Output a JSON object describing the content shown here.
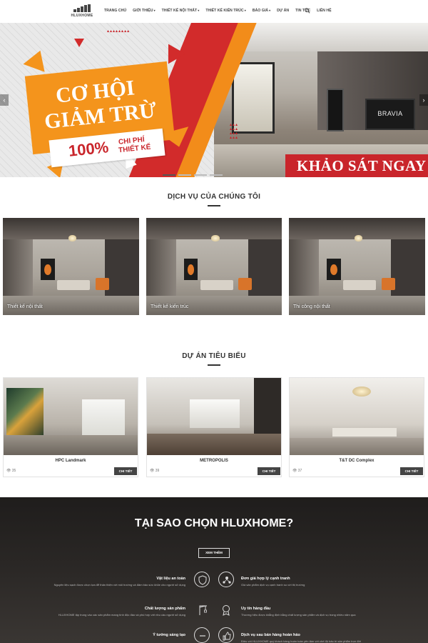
{
  "header": {
    "logo_text": "HLUXHOME",
    "nav": [
      {
        "label": "TRANG CHỦ",
        "caret": false
      },
      {
        "label": "GIỚI THIỆU",
        "caret": true
      },
      {
        "label": "THIẾT KẾ NỘI THẤT",
        "caret": true
      },
      {
        "label": "THIẾT KẾ KIẾN TRÚC",
        "caret": true
      },
      {
        "label": "BÁO GIÁ",
        "caret": true
      },
      {
        "label": "DỰ ÁN",
        "caret": false
      },
      {
        "label": "TIN TỨC",
        "caret": false
      },
      {
        "label": "LIÊN HỆ",
        "caret": false
      }
    ]
  },
  "hero": {
    "headline_line1": "CƠ HỘI",
    "headline_line2": "GIẢM TRỪ",
    "percent": "100%",
    "sub_line1": "CHI PHÍ",
    "sub_line2": "THIẾT KẾ",
    "cta": "KHẢO SÁT NGAY",
    "tv_brand": "BRAVIA",
    "prev_arrow": "‹",
    "next_arrow": "›"
  },
  "services": {
    "title": "DỊCH VỤ CỦA CHÚNG TÔI",
    "items": [
      {
        "label": "Thiết kế nội thất"
      },
      {
        "label": "Thiết kế kiến trúc"
      },
      {
        "label": "Thi công nội thất"
      }
    ]
  },
  "projects": {
    "title": "DỰ ÁN TIÊU BIỂU",
    "items": [
      {
        "name": "HPC Landmark",
        "views": "35",
        "button": "CHI TIẾT"
      },
      {
        "name": "METROPOLIS",
        "views": "39",
        "button": "CHI TIẾT"
      },
      {
        "name": "T&T DC Complex",
        "views": "37",
        "button": "CHI TIẾT"
      }
    ]
  },
  "why": {
    "title": "TẠI SAO CHỌN HLUXHOME?",
    "button": "XEM THÊM",
    "features": [
      {
        "title": "Vật liệu an toàn",
        "desc": "Nguyên liệu sạch được chọn lựa để thân thiện với môi trường và đảm bảo sức khỏe cho người sử dụng",
        "icon": "hand-shield-icon"
      },
      {
        "title": "Đơn giá hợp lý cạnh tranh",
        "desc": "Giá sản phẩm dịch vụ cạnh tranh so với thị trường",
        "icon": "people-network-icon"
      },
      {
        "title": "Chất lượng sản phẩm",
        "desc": "HLUXHOME tập trung vào các sản phẩm mang tính độc đáo và phù hợp với nhu cầu người sử dụng",
        "icon": "crane-icon"
      },
      {
        "title": "Uy tín hàng đầu",
        "desc": "Thương hiệu được khẳng định bằng chất lượng sản phẩm và dịch vụ trong nhiều năm qua",
        "icon": "award-badge-icon"
      },
      {
        "title": "Ý tưởng sáng tạo",
        "desc": "",
        "icon": "idea-icon"
      },
      {
        "title": "Dịch vụ sau bán hàng hoàn hảo",
        "desc": "Điều với HLUXHOME quý khách hàng hoàn toàn yên tâm với chế độ bảo trì sản phẩm trọn đời",
        "icon": "thumbs-up-icon"
      }
    ]
  },
  "colors": {
    "accent_red": "#c9252b",
    "accent_orange": "#f4941c",
    "dark_button": "#444444"
  }
}
